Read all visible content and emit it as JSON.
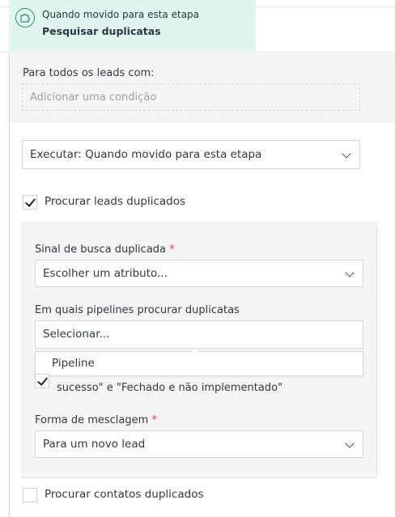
{
  "trigger": {
    "subtitle": "Quando movido para esta etapa",
    "title": "Pesquisar duplicatas",
    "icon": "puzzle-icon"
  },
  "conditions": {
    "label": "Para todos os leads com:",
    "placeholder": "Adicionar uma condição"
  },
  "execute_select": {
    "value": "Executar: Quando movido para esta etapa"
  },
  "search_leads": {
    "checked": true,
    "label": "Procurar leads duplicados"
  },
  "duplicate_signal": {
    "label": "Sinal de busca duplicada",
    "required_mark": "*",
    "value": "Escolher um atributo..."
  },
  "pipelines": {
    "label": "Em quais pipelines procurar duplicatas",
    "value": "Selecionar...",
    "options": [
      "Pipeline"
    ]
  },
  "exclude_closed": {
    "checked": true,
    "label_line2": "sucesso\" e \"Fechado e não implementado\""
  },
  "merge_form": {
    "label": "Forma de mesclagem",
    "required_mark": "*",
    "value": "Para um novo lead"
  },
  "search_contacts": {
    "checked": false,
    "label": "Procurar contatos duplicados"
  },
  "colors": {
    "trigger_bg": "#dff5ee",
    "accent": "#2f8f7b",
    "required": "#e0454c"
  }
}
